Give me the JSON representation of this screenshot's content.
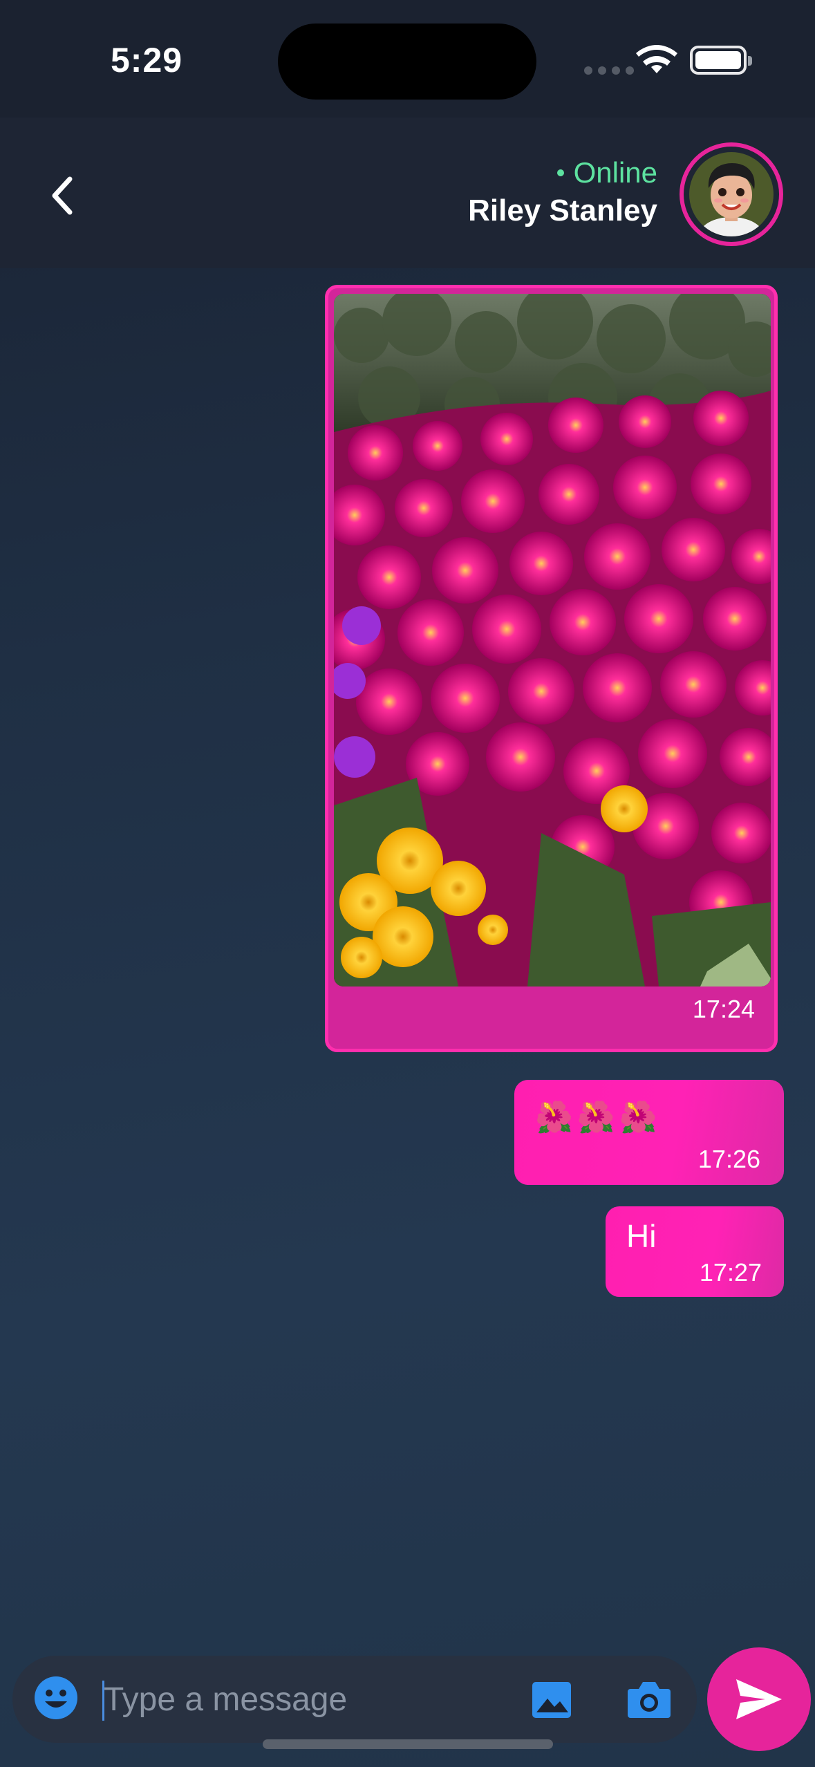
{
  "status_bar": {
    "time": "5:29"
  },
  "header": {
    "status": "Online",
    "contact_name": "Riley Stanley"
  },
  "messages": [
    {
      "type": "image",
      "time": "17:24"
    },
    {
      "type": "text",
      "text": "🌺🌺🌺",
      "time": "17:26"
    },
    {
      "type": "text",
      "text": "Hi",
      "time": "17:27"
    }
  ],
  "composer": {
    "placeholder": "Type a message"
  },
  "colors": {
    "accent": "#e6249b",
    "online": "#5de2a0",
    "icon_blue": "#2f8fee"
  }
}
